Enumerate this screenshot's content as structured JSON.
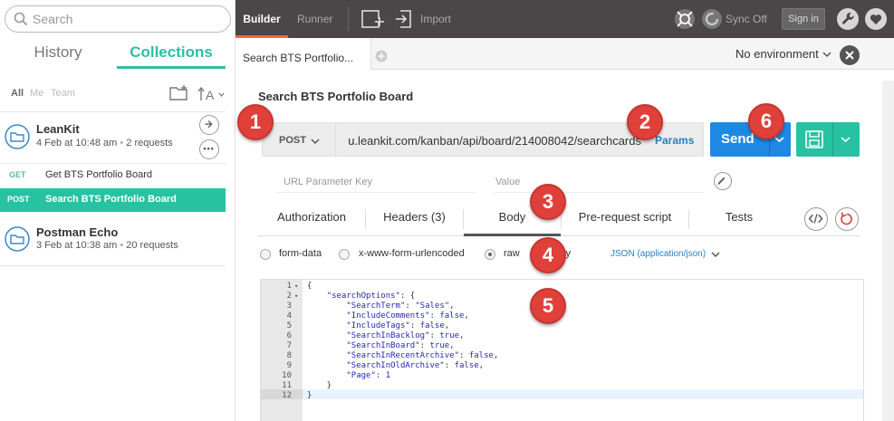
{
  "sidebar": {
    "search_placeholder": "Search",
    "tabs": {
      "history": "History",
      "collections": "Collections"
    },
    "filters": {
      "all": "All",
      "me": "Me",
      "team": "Team"
    },
    "collections": [
      {
        "name": "LeanKit",
        "date": "4 Feb at 10:48 am",
        "count": "2 requests",
        "requests": [
          {
            "method": "GET",
            "name": "Get BTS Portfolio Board"
          },
          {
            "method": "POST",
            "name": "Search BTS Portfolio Board"
          }
        ]
      },
      {
        "name": "Postman Echo",
        "date": "3 Feb at 10:38 am",
        "count": "20 requests"
      }
    ]
  },
  "toolbar": {
    "builder": "Builder",
    "runner": "Runner",
    "import": "Import",
    "sync": "Sync Off",
    "signin": "Sign in"
  },
  "tabbar": {
    "tab_title": "Search BTS Portfolio...",
    "environment": "No environment"
  },
  "request": {
    "title": "Search BTS Portfolio Board",
    "method": "POST",
    "url": "u.leankit.com/kanban/api/board/214008042/searchcards",
    "params_label": "Params",
    "send_label": "Send",
    "param_key_placeholder": "URL Parameter Key",
    "param_value_placeholder": "Value"
  },
  "subtabs": {
    "authorization": "Authorization",
    "headers": "Headers (3)",
    "body": "Body",
    "prerequest": "Pre-request script",
    "tests": "Tests"
  },
  "body_modes": {
    "form_data": "form-data",
    "urlencoded": "x-www-form-urlencoded",
    "raw": "raw",
    "binary": "binary",
    "content_type": "JSON (application/json)"
  },
  "editor_lines": [
    "{",
    "    \"searchOptions\": {",
    "        \"SearchTerm\": \"Sales\",",
    "        \"IncludeComments\": false,",
    "        \"IncludeTags\": false,",
    "        \"SearchInBacklog\": true,",
    "        \"SearchInBoard\": true,",
    "        \"SearchInRecentArchive\": false,",
    "        \"SearchInOldArchive\": false,",
    "        \"Page\": 1",
    "    }",
    "}"
  ],
  "callouts": [
    "1",
    "2",
    "3",
    "4",
    "5",
    "6"
  ],
  "colors": {
    "accent_teal": "#26c2a1",
    "send_blue": "#1e88e5",
    "callout_red": "#e0403a",
    "builder_underline": "#f26b3a",
    "toolbar_bg": "#4b4647"
  }
}
